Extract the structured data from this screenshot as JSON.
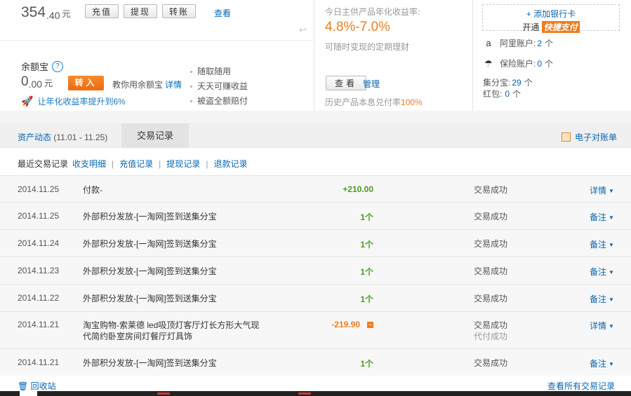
{
  "balance": {
    "int": "354",
    "dec": ".40",
    "unit": "元"
  },
  "top_buttons": [
    "充值",
    "提现",
    "转账"
  ],
  "view_link": "查看",
  "yeb": {
    "title": "余额宝",
    "help": "?",
    "int": "0",
    "dec": ".00",
    "unit": "元",
    "transfer_in": "转入",
    "teach_text": "教你用余额宝",
    "detail_link": "详情",
    "promo": "让年化收益率提升到6%",
    "features": [
      "随取随用",
      "天天可赚收益",
      "被盗全额赔付"
    ]
  },
  "mid": {
    "label": "今日主供产品年化收益率:",
    "rate": "4.8%-7.0%",
    "desc": "可随时变现的定期理财",
    "view_button": "查看",
    "manage_link": "管理",
    "history_prefix": "历史产品本息兑付率",
    "history_rate": "100%"
  },
  "right": {
    "add_card": "+ 添加银行卡",
    "open_text": "开通",
    "quick_pay": "快捷支付",
    "alipay_label": "阿里账户:",
    "alipay_value": "2",
    "alipay_unit": "个",
    "insurance_label": "保险账户:",
    "insurance_value": "0",
    "insurance_unit": "个",
    "jifenbao_label": "集分宝:",
    "jifenbao_value": "29",
    "jifenbao_unit": "个",
    "hongbao_label": "红包:",
    "hongbao_value": "0",
    "hongbao_unit": "个"
  },
  "tabs": {
    "asset_link": "资产动态",
    "asset_range": " (11.01 - 11.25)",
    "record": "交易记录",
    "bill": "电子对账单"
  },
  "subnav": {
    "current": "最近交易记录",
    "links": [
      "收支明细",
      "充值记录",
      "提现记录",
      "退款记录"
    ]
  },
  "rows": [
    {
      "date": "2014.11.25",
      "name": "付款-",
      "amount": "+210.00",
      "status": "交易成功",
      "sub": "",
      "action": "详情"
    },
    {
      "date": "2014.11.25",
      "name": "外部积分发放-[一淘网]签到送集分宝",
      "amount": "1个",
      "status": "交易成功",
      "sub": "",
      "action": "备注"
    },
    {
      "date": "2014.11.24",
      "name": "外部积分发放-[一淘网]签到送集分宝",
      "amount": "1个",
      "status": "交易成功",
      "sub": "",
      "action": "备注"
    },
    {
      "date": "2014.11.23",
      "name": "外部积分发放-[一淘网]签到送集分宝",
      "amount": "1个",
      "status": "交易成功",
      "sub": "",
      "action": "备注"
    },
    {
      "date": "2014.11.22",
      "name": "外部积分发放-[一淘网]签到送集分宝",
      "amount": "1个",
      "status": "交易成功",
      "sub": "",
      "action": "备注"
    },
    {
      "date": "2014.11.21",
      "name": "淘宝购物-索莱德 led吸顶灯客厅灯长方形大气现代简约卧室房间灯餐厅灯具饰",
      "amount": "-219.90",
      "status": "交易成功",
      "sub": "代付成功",
      "action": "详情"
    },
    {
      "date": "2014.11.21",
      "name": "外部积分发放-[一淘网]签到送集分宝",
      "amount": "1个",
      "status": "交易成功",
      "sub": "",
      "action": "备注"
    }
  ],
  "footer": {
    "back": "回收站",
    "all_records": "查看所有交易记录"
  },
  "colors": {
    "link": "#0766b1",
    "orange": "#ef7d1f",
    "green": "#4a9e1f"
  }
}
